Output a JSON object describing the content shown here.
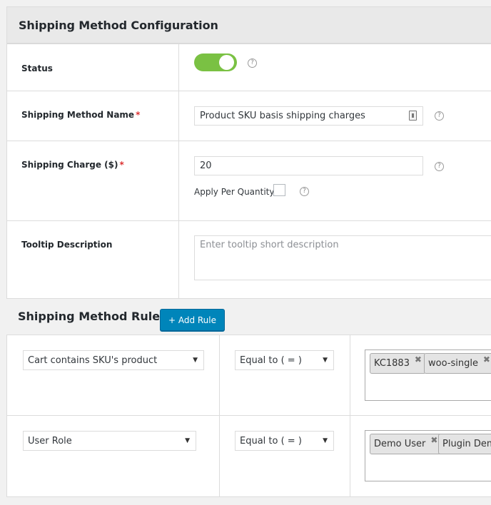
{
  "config": {
    "title": "Shipping Method Configuration",
    "status": {
      "label": "Status",
      "enabled": true
    },
    "method_name": {
      "label": "Shipping Method Name",
      "required_mark": "*",
      "value": "Product SKU basis shipping charges"
    },
    "charge": {
      "label": "Shipping Charge ($)",
      "required_mark": "*",
      "value": "20",
      "apply_per_quantity_label": "Apply Per Quantity",
      "apply_per_quantity_checked": false
    },
    "tooltip": {
      "label": "Tooltip Description",
      "placeholder": "Enter tooltip short description"
    },
    "help_icon": "?"
  },
  "rules": {
    "title": "Shipping Method Rules",
    "add_label": "+ Add Rule",
    "items": [
      {
        "condition": "Cart contains SKU's product",
        "operator": "Equal to ( = )",
        "values": [
          "KC1883",
          "woo-single"
        ]
      },
      {
        "condition": "User Role",
        "operator": "Equal to ( = )",
        "values": [
          "Demo User",
          "Plugin Demo"
        ]
      }
    ],
    "dropdown_arrow": "▼",
    "remove_icon": "✖"
  },
  "colors": {
    "toggle_on": "#7ac143",
    "primary_button": "#0085ba",
    "required": "#dc3232"
  }
}
